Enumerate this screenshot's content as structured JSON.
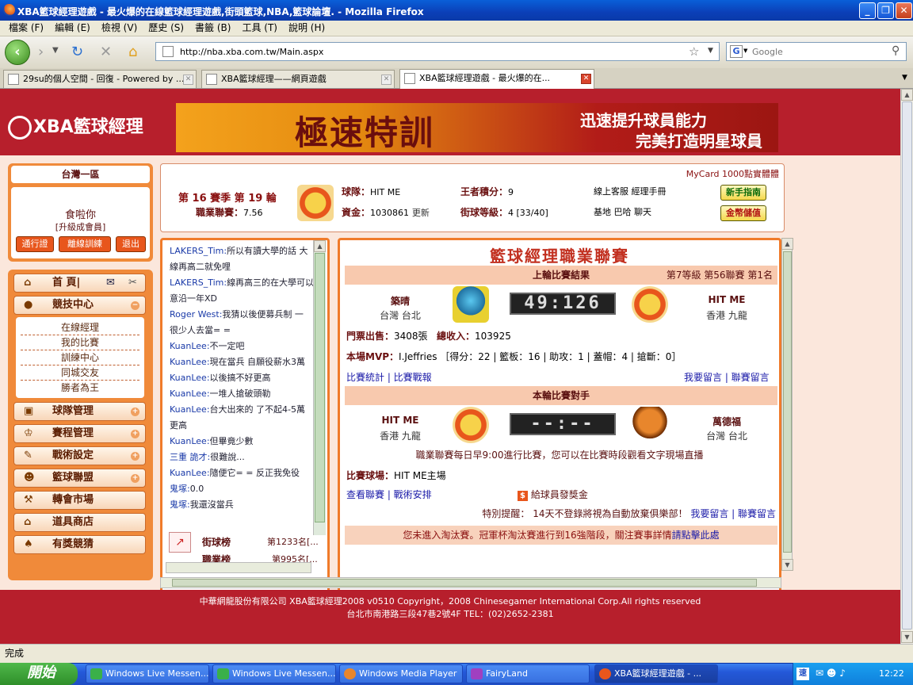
{
  "window": {
    "title": "XBA籃球經理遊戲 - 最火爆的在線籃球經理遊戲,街頭籃球,NBA,籃球論壇. - Mozilla Firefox"
  },
  "menu": [
    "檔案 (F)",
    "編輯 (E)",
    "檢視 (V)",
    "歷史 (S)",
    "書籤 (B)",
    "工具 (T)",
    "說明 (H)"
  ],
  "nav": {
    "url": "http://nba.xba.com.tw/Main.aspx",
    "search_placeholder": "Google"
  },
  "tabs": [
    {
      "label": "29su的個人空間 - 回復 - Powered by ..."
    },
    {
      "label": "XBA籃球經理——網頁遊戲"
    },
    {
      "label": "XBA籃球經理遊戲 - 最火爆的在..."
    }
  ],
  "header": {
    "logo": "XBA籃球經理",
    "banner_main": "極速特訓",
    "banner_line1": "迅速提升球員能力",
    "banner_line2": "完美打造明星球員"
  },
  "left": {
    "region": "台灣一區",
    "user": "食啦你",
    "member": "[升級成會員]",
    "buttons": [
      "通行證",
      "離線訓練",
      "退出"
    ],
    "menu": [
      {
        "label": "首 頁|"
      },
      {
        "label": "競技中心"
      },
      {
        "label": "球隊管理"
      },
      {
        "label": "賽程管理"
      },
      {
        "label": "戰術設定"
      },
      {
        "label": "籃球聯盟"
      },
      {
        "label": "轉會市場"
      },
      {
        "label": "道具商店"
      },
      {
        "label": "有獎競猜"
      }
    ],
    "sub": [
      "在線經理",
      "我的比賽",
      "訓練中心",
      "同城交友",
      "勝者為王"
    ]
  },
  "info": {
    "mycard": "MyCard 1000點實體體",
    "season": "第 16 賽季 第 19 輪",
    "league_label": "職業聯賽：",
    "league_value": "7.56",
    "team_label": "球隊：",
    "team_value": "HIT ME",
    "funds_label": "資金：",
    "funds_value": "1030861",
    "refresh": "更新",
    "king_label": "王者積分：",
    "king_value": "9",
    "street_label": "街球等級：",
    "street_value": "4 [33/40]",
    "links1": "線上客服 經理手冊",
    "links2": "基地 巴哈 聊天",
    "btn_guide": "新手指南",
    "btn_gold": "金幣儲值"
  },
  "chat": [
    {
      "name": "LAKERS_Tim:",
      "text": "所以有讀大學的話 大"
    },
    {
      "name": "",
      "text": "線再高二就免哩"
    },
    {
      "name": "LAKERS_Tim:",
      "text": "線再高三的在大學可以"
    },
    {
      "name": "",
      "text": "意沿一年XD"
    },
    {
      "name": "Roger West:",
      "text": "我猜以後便募兵制 一"
    },
    {
      "name": "",
      "text": "很少人去當= ="
    },
    {
      "name": "KuanLee:",
      "text": "不一定吧"
    },
    {
      "name": "KuanLee:",
      "text": "現在當兵 自願役薪水3萬"
    },
    {
      "name": "KuanLee:",
      "text": "以後搞不好更高"
    },
    {
      "name": "KuanLee:",
      "text": "一堆人搶破頭勒"
    },
    {
      "name": "KuanLee:",
      "text": "台大出來的 了不起4-5萬"
    },
    {
      "name": "",
      "text": "更高"
    },
    {
      "name": "KuanLee:",
      "text": "但畢竟少數"
    },
    {
      "name": "三重 詭才:",
      "text": "很難說..."
    },
    {
      "name": "KuanLee:",
      "text": "隨便它= = 反正我免役"
    },
    {
      "name": "鬼塚:",
      "text": "0.0"
    },
    {
      "name": "鬼塚:",
      "text": "我還沒當兵"
    }
  ],
  "ranks": [
    {
      "label": "街球榜",
      "value": "第1233名[..."
    },
    {
      "label": "職業榜",
      "value": "第995名[..."
    }
  ],
  "league": {
    "title": "籃球經理職業聯賽",
    "last_title": "上輪比賽結果",
    "last_rank": "第7等級 第56聯賽 第1名",
    "home_team": "築晴",
    "home_loc": "台灣 台北",
    "score": "49:126",
    "away_team": "HIT ME",
    "away_loc": "香港 九龍",
    "tickets_label": "門票出售：",
    "tickets_value": "3408張",
    "income_label": "總收入：",
    "income_value": "103925",
    "mvp_label": "本場MVP：",
    "mvp_value": "I.Jeffries ［得分：22 | 籃板：16 | 助攻：1 | 蓋帽：4 | 搶斷：0］",
    "stats_links": "比賽統計 | 比賽戰報",
    "msg_links": "我要留言 | 聯賽留言",
    "next_title": "本輪比賽對手",
    "next_home": "HIT ME",
    "next_home_loc": "香港 九龍",
    "next_score": "--:--",
    "next_away": "萬德福",
    "next_away_loc": "台灣 台北",
    "notice": "職業聯賽每日早9:00進行比賽，您可以在比賽時段觀看文字現場直播",
    "court_label": "比賽球場：",
    "court_value": "HIT ME主場",
    "view_links": "查看聯賽 | 戰術安排",
    "bonus": "給球員發獎金",
    "reminder": "特別提醒： 14天不登錄將視為自動放棄俱樂部！",
    "msg_links2": "我要留言 | 聯賽留言",
    "cup": "您未進入淘汰賽。冠軍杯淘汰賽進行到16強階段，關注賽事詳情",
    "cup_link": "請點擊此處"
  },
  "footer": {
    "line1": "中華網龍股份有限公司 XBA籃球經理2008 v0510     Copyright，2008 Chinesegamer International Corp.All rights reserved",
    "line2": "台北市南港路三段47巷2號4F TEL：(02)2652-2381"
  },
  "status": "完成",
  "taskbar": {
    "start": "開始",
    "items": [
      "Windows Live Messen...",
      "Windows Live Messen...",
      "Windows Media Player",
      "FairyLand",
      "XBA籃球經理遊戲 - ..."
    ],
    "clock": "12:22"
  },
  "colors": {
    "brand_red": "#b71f2c",
    "orange": "#f07b2a"
  }
}
